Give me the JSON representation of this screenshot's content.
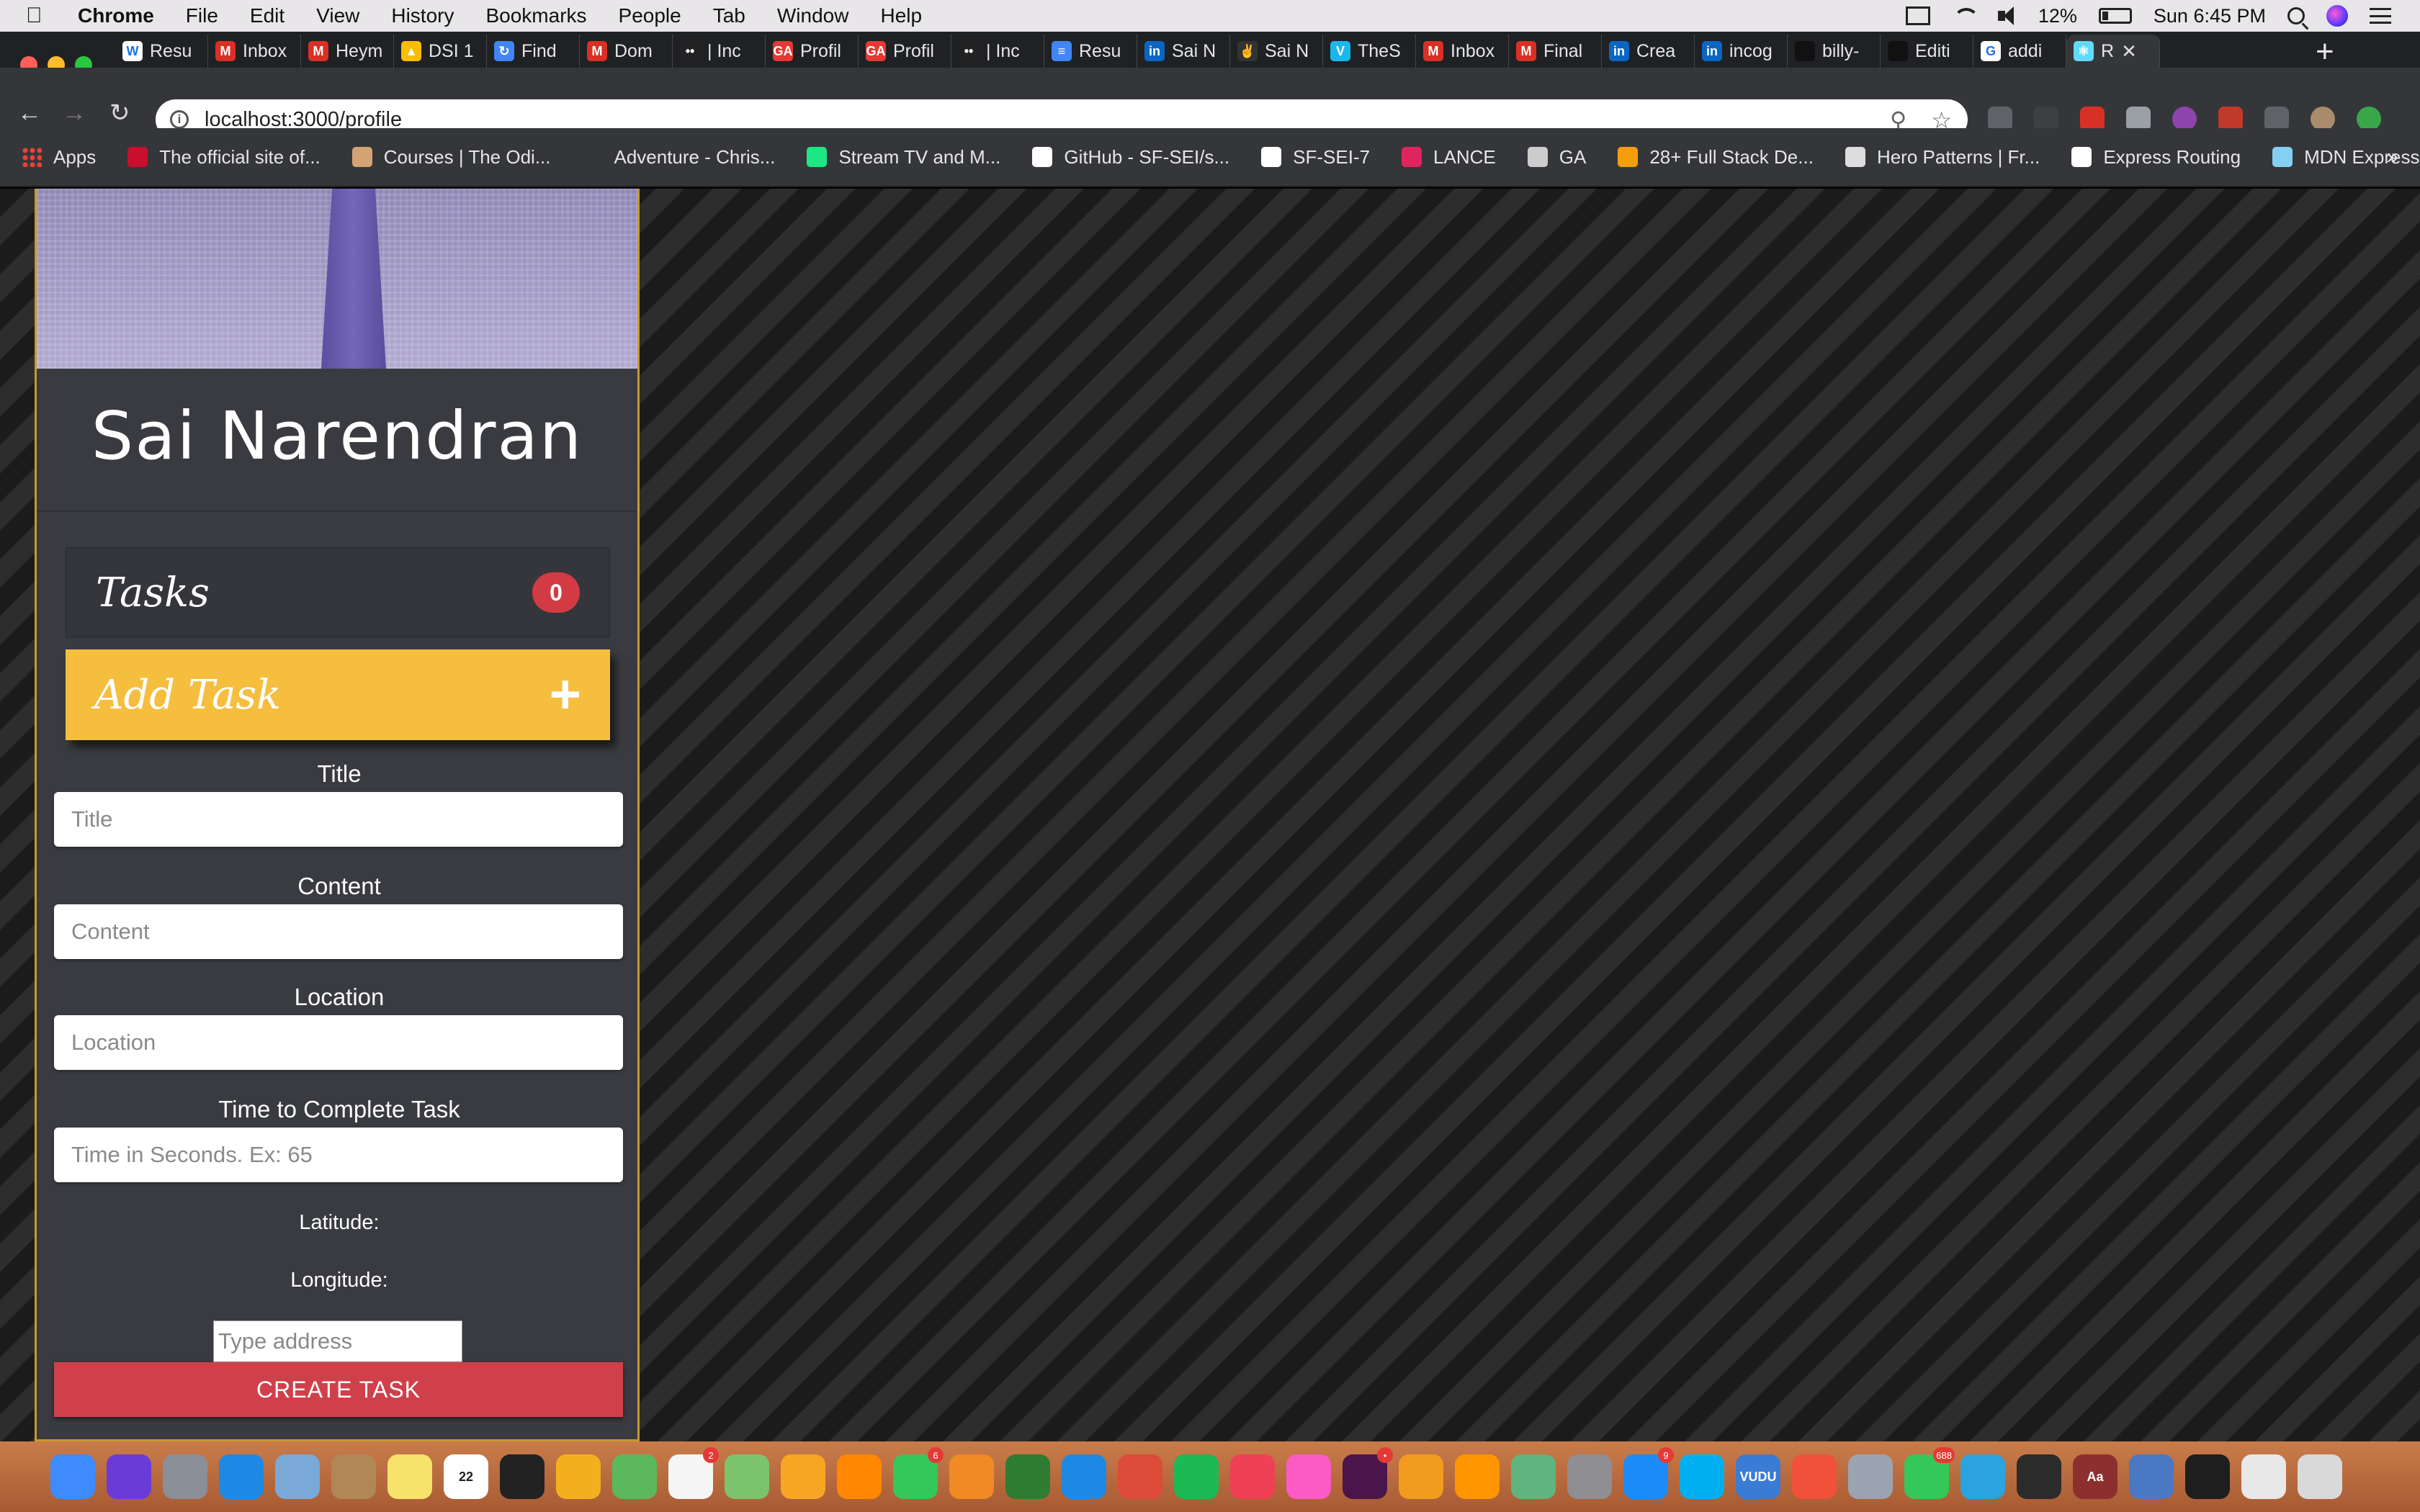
{
  "menubar": {
    "app_name": "Chrome",
    "menus": [
      "File",
      "Edit",
      "View",
      "History",
      "Bookmarks",
      "People",
      "Tab",
      "Window",
      "Help"
    ],
    "battery": "12%",
    "clock": "Sun 6:45 PM"
  },
  "tabs": [
    {
      "label": "Resu",
      "icon_color": "#ffffff",
      "glyph": "W"
    },
    {
      "label": "Inbox",
      "icon_color": "#d93025",
      "glyph": "M"
    },
    {
      "label": "Heym",
      "icon_color": "#d93025",
      "glyph": "M"
    },
    {
      "label": "DSI 1",
      "icon_color": "#fbbc04",
      "glyph": "▲"
    },
    {
      "label": "Find",
      "icon_color": "#4285f4",
      "glyph": "↻"
    },
    {
      "label": "Dom",
      "icon_color": "#d93025",
      "glyph": "M"
    },
    {
      "label": "| Inc",
      "icon_color": "#222222",
      "glyph": "••"
    },
    {
      "label": "Profil",
      "icon_color": "#e53935",
      "glyph": "GA"
    },
    {
      "label": "Profil",
      "icon_color": "#e53935",
      "glyph": "GA"
    },
    {
      "label": "| Inc",
      "icon_color": "#222222",
      "glyph": "••"
    },
    {
      "label": "Resu",
      "icon_color": "#4285f4",
      "glyph": "≡"
    },
    {
      "label": "Sai N",
      "icon_color": "#0a66c2",
      "glyph": "in"
    },
    {
      "label": "Sai N",
      "icon_color": "#333333",
      "glyph": "✌"
    },
    {
      "label": "TheS",
      "icon_color": "#1ab7ea",
      "glyph": "V"
    },
    {
      "label": "Inbox",
      "icon_color": "#d93025",
      "glyph": "M"
    },
    {
      "label": "Final",
      "icon_color": "#d93025",
      "glyph": "M"
    },
    {
      "label": "Crea",
      "icon_color": "#0a66c2",
      "glyph": "in"
    },
    {
      "label": "incog",
      "icon_color": "#0a66c2",
      "glyph": "in"
    },
    {
      "label": "billy-",
      "icon_color": "#111111",
      "glyph": ""
    },
    {
      "label": "Editi",
      "icon_color": "#111111",
      "glyph": ""
    },
    {
      "label": "addi",
      "icon_color": "#ffffff",
      "glyph": "G"
    },
    {
      "label": "R",
      "icon_color": "#61dafb",
      "glyph": "⚛",
      "active": true
    }
  ],
  "address_bar": {
    "url": "localhost:3000/profile"
  },
  "bookmarks": [
    {
      "label": "Apps",
      "icon": "apps-grid-icon"
    },
    {
      "label": "The official site of...",
      "icon": "nba-icon",
      "color": "#c8102e"
    },
    {
      "label": "Courses | The Odi...",
      "icon": "odin-icon",
      "color": "#d4a373"
    },
    {
      "label": "Adventure - Chris...",
      "icon": "bookmark-icon",
      "color": "#35363a"
    },
    {
      "label": "Stream TV and M...",
      "icon": "hulu-icon",
      "color": "#1ce783"
    },
    {
      "label": "GitHub - SF-SEI/s...",
      "icon": "github-icon",
      "color": "#ffffff"
    },
    {
      "label": "SF-SEI-7",
      "icon": "github-icon",
      "color": "#ffffff"
    },
    {
      "label": "LANCE",
      "icon": "lance-icon",
      "color": "#e0245e"
    },
    {
      "label": "GA",
      "icon": "folder-icon",
      "color": "#cccccc"
    },
    {
      "label": "28+ Full Stack De...",
      "icon": "coffee-icon",
      "color": "#f59e0b"
    },
    {
      "label": "Hero Patterns | Fr...",
      "icon": "globe-icon",
      "color": "#dddddd"
    },
    {
      "label": "Express Routing",
      "icon": "github-icon",
      "color": "#ffffff"
    },
    {
      "label": "MDN Express",
      "icon": "mdn-icon",
      "color": "#83d0f2"
    }
  ],
  "profile": {
    "name": "Sai Narendran"
  },
  "tasks": {
    "title": "Tasks",
    "count": "0"
  },
  "add_task": {
    "label": "Add Task",
    "plus": "+"
  },
  "form": {
    "title_label": "Title",
    "title_placeholder": "Title",
    "content_label": "Content",
    "content_placeholder": "Content",
    "location_label": "Location",
    "location_placeholder": "Location",
    "time_label": "Time to Complete Task",
    "time_placeholder": "Time in Seconds. Ex: 65",
    "latitude_label": "Latitude:",
    "longitude_label": "Longitude:",
    "address_placeholder": "Type address",
    "submit_label": "CREATE TASK"
  },
  "colors": {
    "accent_yellow": "#f5be3e",
    "badge_red": "#d23b44",
    "create_button_red": "#d0404a",
    "card_border": "#c79a2e"
  },
  "dock": {
    "icons": [
      {
        "name": "finder-icon",
        "color": "#3d8bfd"
      },
      {
        "name": "siri-icon",
        "color": "#6b3bd8"
      },
      {
        "name": "launchpad-icon",
        "color": "#8a8f98"
      },
      {
        "name": "safari-icon",
        "color": "#1e88e5"
      },
      {
        "name": "preview-icon",
        "color": "#7aa9d8"
      },
      {
        "name": "contacts-icon",
        "color": "#b08756"
      },
      {
        "name": "notes-icon",
        "color": "#f7e26b"
      },
      {
        "name": "calendar-icon",
        "color": "#ffffff",
        "label": "22"
      },
      {
        "name": "digital-clock-icon",
        "color": "#222222"
      },
      {
        "name": "vectorworks-icon",
        "color": "#f2b01e"
      },
      {
        "name": "paw-icon",
        "color": "#5cb85c"
      },
      {
        "name": "reminders-icon",
        "color": "#f5f5f5",
        "badge": "2"
      },
      {
        "name": "maps-icon",
        "color": "#7cc36d"
      },
      {
        "name": "photos-icon",
        "color": "#f6a623"
      },
      {
        "name": "vlc-icon",
        "color": "#ff8800"
      },
      {
        "name": "facetime-icon",
        "color": "#34c759",
        "badge": "6"
      },
      {
        "name": "pages-icon",
        "color": "#f08a24"
      },
      {
        "name": "numbers-icon",
        "color": "#2e7d32"
      },
      {
        "name": "keynote-icon",
        "color": "#1e88e5"
      },
      {
        "name": "chrome-icon",
        "color": "#dd4b39"
      },
      {
        "name": "spotify-icon",
        "color": "#1db954"
      },
      {
        "name": "pocket-icon",
        "color": "#ef4056"
      },
      {
        "name": "itunes-icon",
        "color": "#fb5bc5"
      },
      {
        "name": "slack-icon",
        "color": "#4a154b",
        "badge": "•"
      },
      {
        "name": "sublime-icon",
        "color": "#f29c1f"
      },
      {
        "name": "ibooks-icon",
        "color": "#ff9500"
      },
      {
        "name": "atom-icon",
        "color": "#5fb57d"
      },
      {
        "name": "system-preferences-icon",
        "color": "#8e8e93"
      },
      {
        "name": "app-store-icon",
        "color": "#1d8cf8",
        "badge": "9"
      },
      {
        "name": "skype-icon",
        "color": "#00aff0"
      },
      {
        "name": "vudu-icon",
        "color": "#3a7bd5",
        "label": "VUDU"
      },
      {
        "name": "swift-icon",
        "color": "#f05138"
      },
      {
        "name": "image-capture-icon",
        "color": "#9aa4b1"
      },
      {
        "name": "messages-icon",
        "color": "#34c759",
        "badge": "688"
      },
      {
        "name": "telegram-icon",
        "color": "#2aa3df"
      },
      {
        "name": "activity-monitor-icon",
        "color": "#2b2b2b"
      },
      {
        "name": "dictionary-icon",
        "color": "#8e2f2f",
        "label": "Aa"
      },
      {
        "name": "chrome-canary-icon",
        "color": "#4a78c2"
      },
      {
        "name": "terminal-icon",
        "color": "#1e1e1e"
      },
      {
        "name": "documents-stack-icon",
        "color": "#e8e8e8"
      },
      {
        "name": "trash-icon",
        "color": "#d9d9d9"
      }
    ]
  }
}
